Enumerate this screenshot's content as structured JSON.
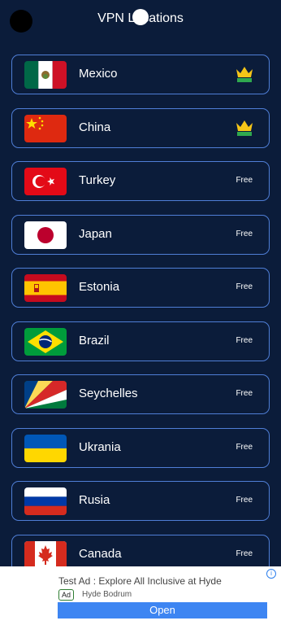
{
  "header": {
    "title": "VPN Locations"
  },
  "locations": [
    {
      "name": "Mexico",
      "tier": "premium",
      "badge_icon": "crown-icon",
      "flag_icon": "mexico-flag-icon"
    },
    {
      "name": "China",
      "tier": "premium",
      "badge_icon": "crown-icon",
      "flag_icon": "china-flag-icon"
    },
    {
      "name": "Turkey",
      "tier": "free",
      "badge": "Free",
      "flag_icon": "turkey-flag-icon"
    },
    {
      "name": "Japan",
      "tier": "free",
      "badge": "Free",
      "flag_icon": "japan-flag-icon"
    },
    {
      "name": "Estonia",
      "tier": "free",
      "badge": "Free",
      "flag_icon": "spain-flag-icon"
    },
    {
      "name": "Brazil",
      "tier": "free",
      "badge": "Free",
      "flag_icon": "brazil-flag-icon"
    },
    {
      "name": "Seychelles",
      "tier": "free",
      "badge": "Free",
      "flag_icon": "seychelles-flag-icon"
    },
    {
      "name": "Ukrania",
      "tier": "free",
      "badge": "Free",
      "flag_icon": "ukraine-flag-icon"
    },
    {
      "name": "Rusia",
      "tier": "free",
      "badge": "Free",
      "flag_icon": "russia-flag-icon"
    },
    {
      "name": "Canada",
      "tier": "free",
      "badge": "Free",
      "flag_icon": "canada-flag-icon"
    }
  ],
  "ad": {
    "title": "Test Ad : Explore All Inclusive at Hyde",
    "badge": "Ad",
    "advertiser": "Hyde Bodrum",
    "button": "Open",
    "info_icon": "i"
  },
  "colors": {
    "background": "#0b1c3a",
    "row_border": "#4f7ed6",
    "ad_button": "#3d85f2"
  }
}
